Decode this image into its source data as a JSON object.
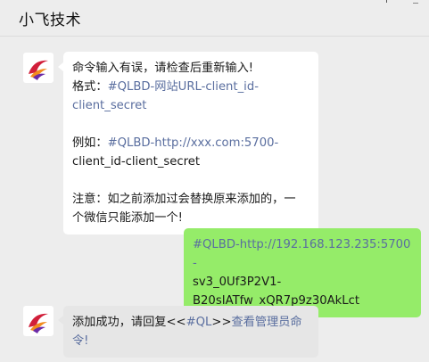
{
  "header": {
    "title": "小飞技术"
  },
  "messages": [
    {
      "side": "left",
      "lines": [
        {
          "text": "命令输入有误，请检查后重新输入!",
          "link": ""
        },
        {
          "text": "格式：",
          "link": "#QLBD-网站URL-client_id-"
        },
        {
          "text": "",
          "link": "client_secret"
        },
        {
          "text": "",
          "link": ""
        },
        {
          "text": "例如：",
          "link": "#QLBD-http://xxx.com:5700-"
        },
        {
          "text": "client_id-client_secret",
          "link": ""
        },
        {
          "text": "",
          "link": ""
        },
        {
          "text": "注意：如之前添加过会替换原来添加的，一",
          "link": ""
        },
        {
          "text": "个微信只能添加一个!",
          "link": ""
        }
      ]
    },
    {
      "side": "right",
      "lines": [
        "#QLBD-http://192.168.123.235:5700-",
        "sv3_0Uf3P2V1-",
        "B20sIATfw_xQR7p9z30AkLct"
      ]
    },
    {
      "side": "left",
      "line1_prefix": "添加成功，请回复<<",
      "line1_link": "#QL",
      "line1_mid": ">>",
      "line1_link2": "查看管理员命",
      "line2_link": "令!"
    }
  ]
}
